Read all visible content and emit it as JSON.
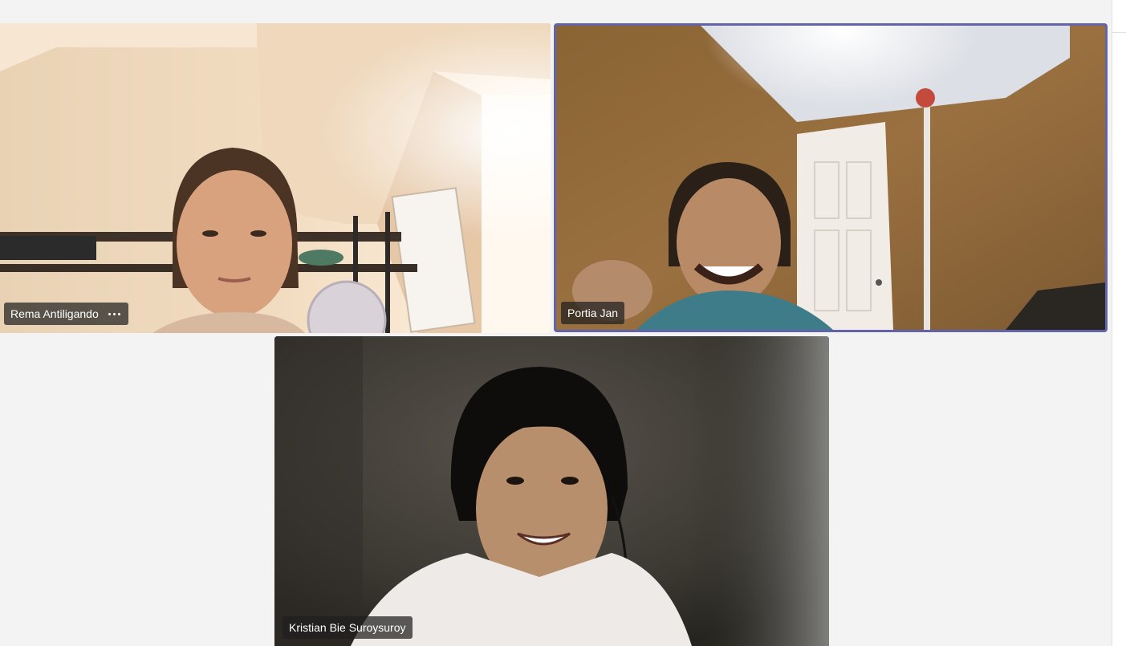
{
  "participants": [
    {
      "name": "Rema Antiligando",
      "has_more_menu": true,
      "speaking": false
    },
    {
      "name": "Portia Jan",
      "has_more_menu": false,
      "speaking": true
    },
    {
      "name": "Kristian Bie Suroysuroy",
      "has_more_menu": false,
      "speaking": false
    }
  ],
  "colors": {
    "background": "#f3f3f3",
    "active_speaker_border": "#6264a7",
    "label_background": "#1e1e1e",
    "label_text": "#ffffff"
  },
  "icons": {
    "more_options": "more-horizontal-icon"
  }
}
